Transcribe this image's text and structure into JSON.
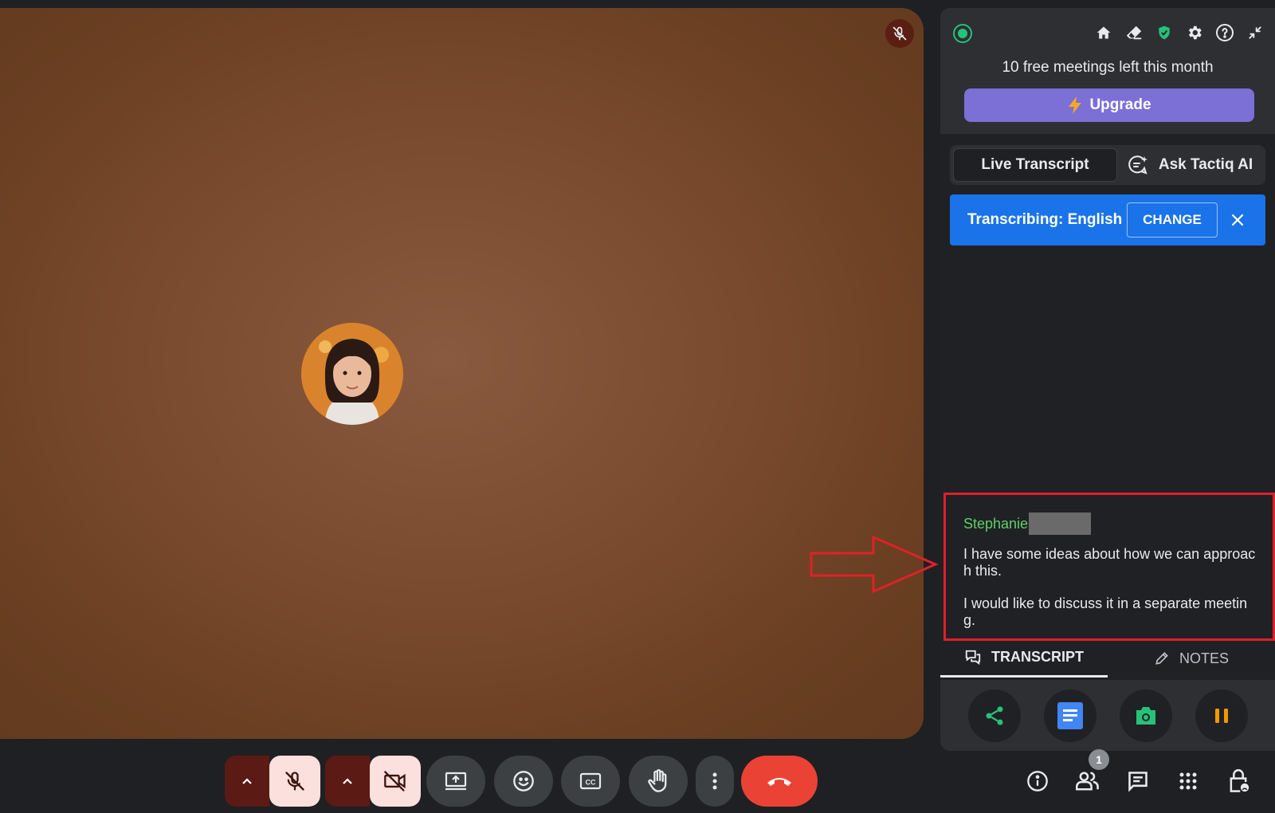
{
  "panel": {
    "free_meetings_text": "10 free meetings left this month",
    "upgrade_label": "Upgrade",
    "tabs": {
      "live_transcript": "Live Transcript",
      "ask_ai": "Ask Tactiq AI"
    },
    "language_bar": {
      "text": "Transcribing: English",
      "change_label": "CHANGE"
    },
    "transcript": {
      "speaker": "Stephanie",
      "lines": [
        "I have some ideas about how we can approach this.",
        "I would like to discuss it in a separate meeting."
      ]
    },
    "bottom_tabs": {
      "transcript": "TRANSCRIPT",
      "notes": "NOTES"
    },
    "head_icons": [
      "home-icon",
      "eraser-icon",
      "shield-check-icon",
      "gear-icon",
      "help-icon",
      "minimize-icon"
    ],
    "actions": [
      "share-icon",
      "document-icon",
      "camera-icon",
      "pause-icon"
    ]
  },
  "call_controls": {
    "buttons": [
      "mic-off-icon",
      "camera-off-icon",
      "present-screen-icon",
      "emoji-icon",
      "captions-icon",
      "raise-hand-icon",
      "more-options-icon",
      "end-call-icon"
    ],
    "right_icons": [
      "info-icon",
      "people-icon",
      "chat-icon",
      "apps-icon",
      "host-controls-icon"
    ],
    "people_count": "1"
  },
  "colors": {
    "accent_green": "#27c17a",
    "upgrade_purple": "#7c6fd6",
    "language_blue": "#1a73e8",
    "highlight_red": "#e0202a",
    "end_call_red": "#ea4335",
    "speaker_green": "#5ecf6a"
  }
}
